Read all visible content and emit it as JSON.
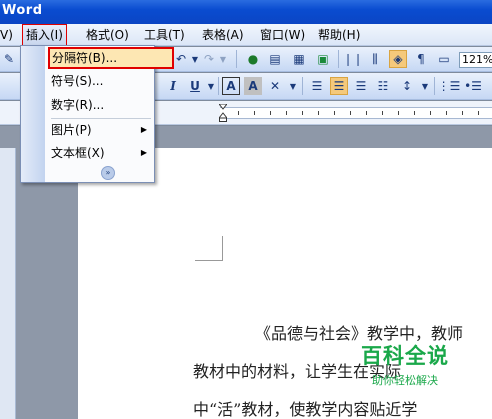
{
  "app": {
    "title": "Word"
  },
  "menubar": {
    "items": [
      {
        "label": "V)"
      },
      {
        "label": "插入(I)"
      },
      {
        "label": "格式(O)"
      },
      {
        "label": "工具(T)"
      },
      {
        "label": "表格(A)"
      },
      {
        "label": "窗口(W)"
      },
      {
        "label": "帮助(H)"
      }
    ]
  },
  "insert_menu": {
    "items": [
      {
        "label": "分隔符(B)...",
        "has_submenu": false
      },
      {
        "label": "符号(S)...",
        "has_submenu": false
      },
      {
        "label": "数字(R)...",
        "has_submenu": false
      },
      {
        "label": "图片(P)",
        "has_submenu": true
      },
      {
        "label": "文本框(X)",
        "has_submenu": true
      }
    ],
    "expand_icon": "double-chevron-down"
  },
  "toolbar": {
    "zoom": "121%",
    "italic_label": "I",
    "underline_label": "U",
    "char_border_label": "A",
    "char_shading_label": "A"
  },
  "document": {
    "lines": [
      "《品德与社会》教学中，教师",
      "教材中的材料，让学生在实际",
      "中“活”教材，使教学内容贴近学"
    ]
  },
  "watermark": {
    "title": "百科全说",
    "subtitle": "助你轻松解决"
  },
  "colors": {
    "titlebar": "#0a4cd0",
    "highlight_border": "#e00000",
    "watermark": "#1aa84a"
  }
}
